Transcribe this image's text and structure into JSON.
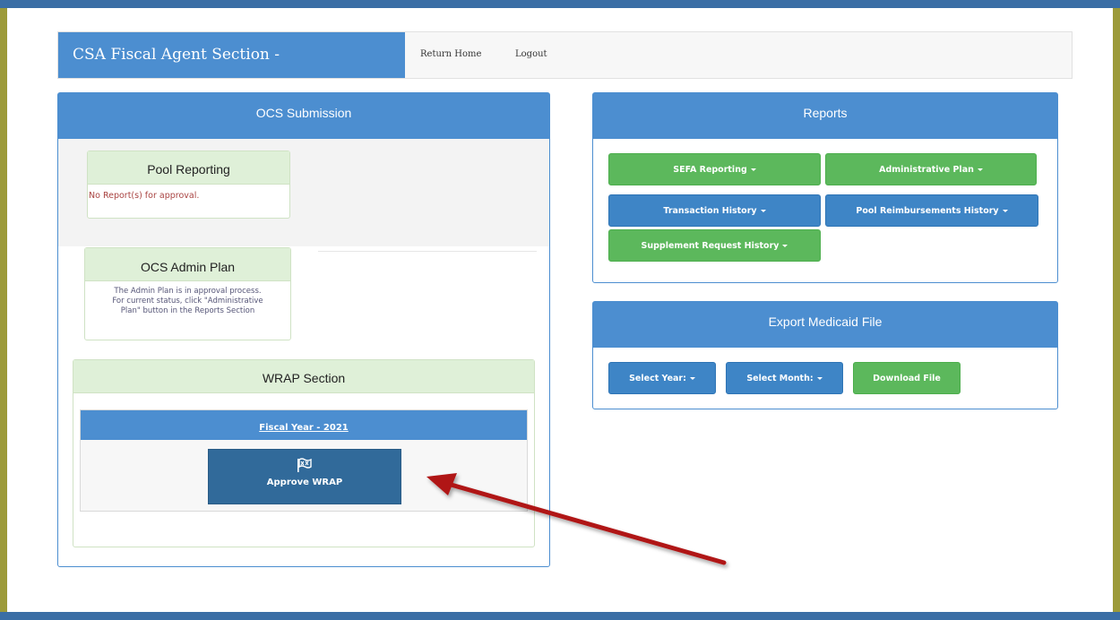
{
  "colors": {
    "brand_blue": "#4c8ed0",
    "button_green": "#5cb85c",
    "button_blue": "#3e85c6",
    "approve_blue": "#316a9a",
    "frame_olive": "#9c9a3a",
    "arrow_red": "#b01818"
  },
  "navbar": {
    "brand": "CSA Fiscal Agent Section -",
    "links": [
      "Return Home",
      "Logout"
    ]
  },
  "ocs": {
    "title": "OCS Submission",
    "pool": {
      "title": "Pool Reporting",
      "message": "No Report(s) for approval."
    },
    "admin": {
      "title": "OCS Admin Plan",
      "message_lines": [
        "The Admin Plan is in approval process.",
        "For current status, click \"Administrative",
        "Plan\" button in the Reports Section"
      ]
    },
    "wrap": {
      "title": "WRAP Section",
      "fiscal_year": "Fiscal Year - 2021",
      "approve_label": "Approve WRAP",
      "approve_icon": "flag-icon"
    }
  },
  "reports": {
    "title": "Reports",
    "buttons": [
      "SEFA Reporting",
      "Administrative Plan",
      "Transaction History",
      "Pool Reimbursements History",
      "Supplement Request History"
    ]
  },
  "export": {
    "title": "Export Medicaid File",
    "select_year": "Select Year:",
    "select_month": "Select Month:",
    "download": "Download File"
  },
  "annotation": {
    "icon": "red-arrow-icon"
  }
}
